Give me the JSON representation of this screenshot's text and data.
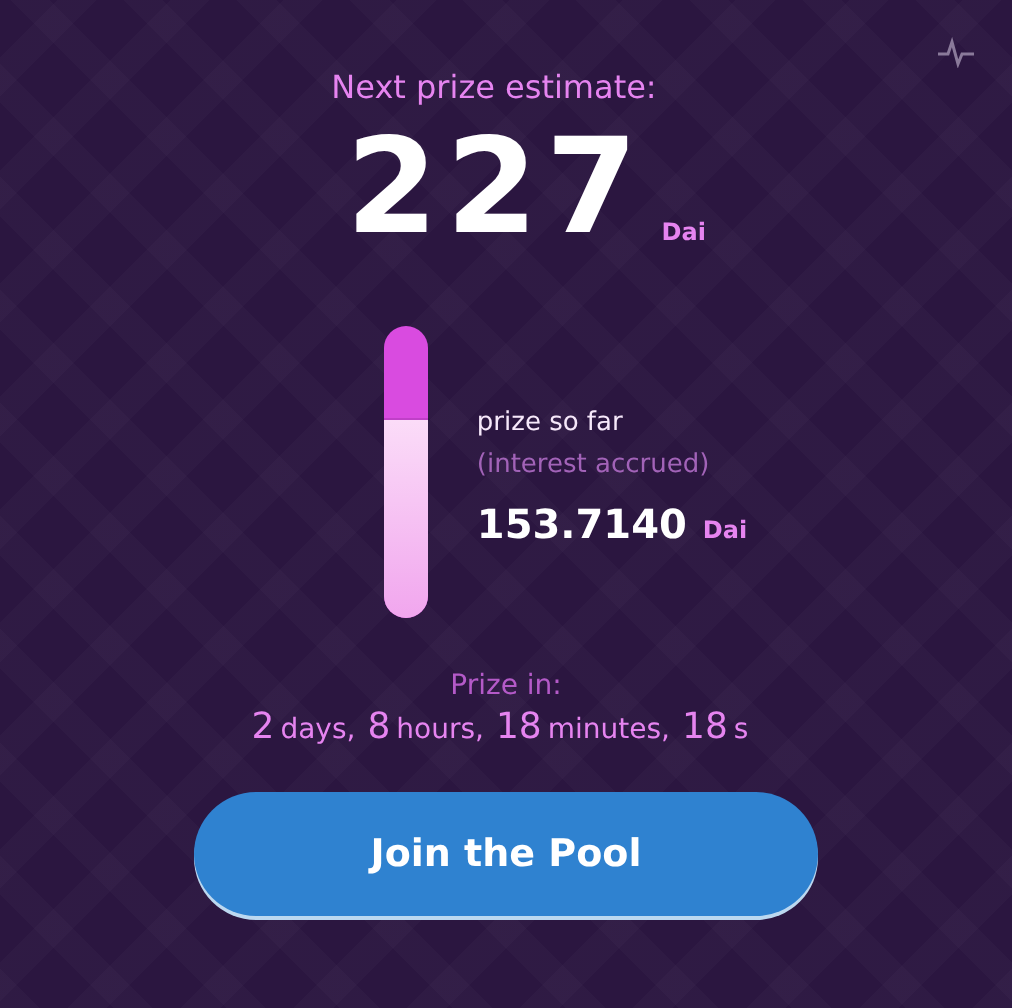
{
  "estimate": {
    "label": "Next prize estimate:",
    "amount": "227",
    "unit": "Dai"
  },
  "prize": {
    "level": 0.68,
    "label": "prize so far",
    "note": "(interest accrued)",
    "amount": "153.7140",
    "unit": "Dai"
  },
  "countdown": {
    "label": "Prize in:",
    "parts": [
      {
        "value": "2",
        "unit": "days,"
      },
      {
        "value": "8",
        "unit": "hours,"
      },
      {
        "value": "18",
        "unit": "minutes,"
      },
      {
        "value": "18",
        "unit": "s"
      }
    ]
  },
  "button": "Join the Pool"
}
